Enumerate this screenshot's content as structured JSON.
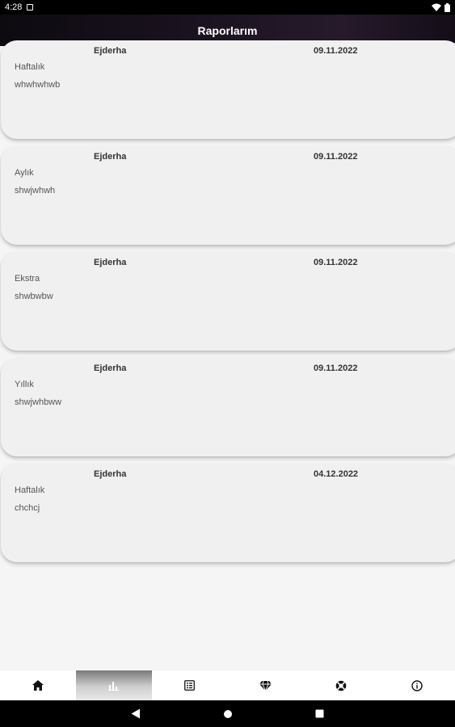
{
  "status_bar": {
    "time": "4:28",
    "icons": [
      "notification-icon",
      "wifi-icon",
      "battery-icon"
    ]
  },
  "app_bar": {
    "title": "Raporlarım"
  },
  "reports": [
    {
      "name": "Ejderha",
      "date": "09.11.2022",
      "type": "Haftalık",
      "note": "whwhwhwb"
    },
    {
      "name": "Ejderha",
      "date": "09.11.2022",
      "type": "Aylık",
      "note": "shwjwhwh"
    },
    {
      "name": "Ejderha",
      "date": "09.11.2022",
      "type": "Ekstra",
      "note": "shwbwbw"
    },
    {
      "name": "Ejderha",
      "date": "09.11.2022",
      "type": "Yıllık",
      "note": "shwjwhbww"
    },
    {
      "name": "Ejderha",
      "date": "04.12.2022",
      "type": "Haftalık",
      "note": "chchcj"
    }
  ],
  "bottom_nav": {
    "active_index": 1,
    "items": [
      "home-icon",
      "bar-chart-icon",
      "list-icon",
      "diamond-icon",
      "support-icon",
      "info-icon"
    ]
  },
  "system_nav": [
    "back-icon",
    "home-button-icon",
    "recents-icon"
  ]
}
